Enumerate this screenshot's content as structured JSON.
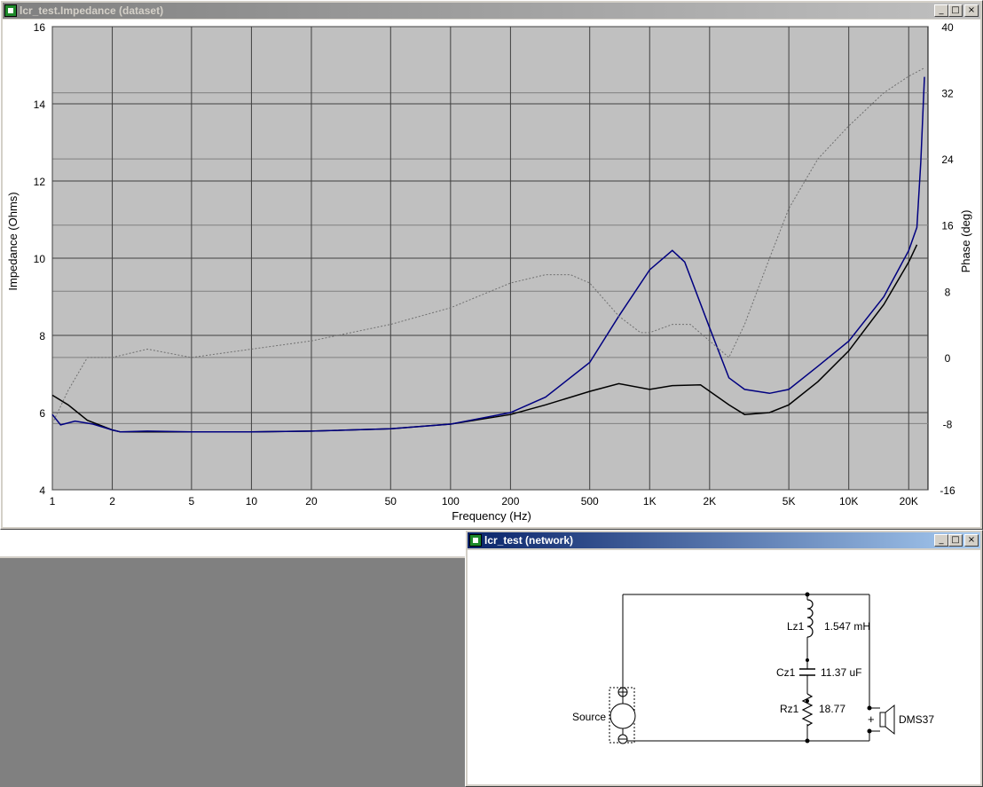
{
  "impedance_window": {
    "title": "lcr_test.Impedance (dataset)",
    "min_label": "_",
    "max_label": "□",
    "close_label": "×"
  },
  "network_window": {
    "title": "lcr_test (network)",
    "min_label": "_",
    "max_label": "□",
    "close_label": "×"
  },
  "schematic": {
    "source_label": "Source",
    "inductor_name": "Lz1",
    "inductor_value": "1.547 mH",
    "capacitor_name": "Cz1",
    "capacitor_value": "11.37 uF",
    "resistor_name": "Rz1",
    "resistor_value": "18.77",
    "driver_name": "DMS37",
    "plus_sign": "+"
  },
  "colors": {
    "plot_bg": "#c0c0c0",
    "grid": "#404040",
    "magnitude_blue": "#000080",
    "magnitude_black": "#000000",
    "phase_dotted": "#707070",
    "active_title": "#0a246a"
  },
  "chart_data": {
    "type": "line",
    "title": "",
    "xlabel": "Frequency (Hz)",
    "ylabel": "Impedance (Ohms)",
    "y2label": "Phase (deg)",
    "xscale": "log",
    "xlim": [
      1,
      25000
    ],
    "ylim": [
      4,
      16
    ],
    "y2lim": [
      -16,
      40
    ],
    "grid": true,
    "x_ticks": [
      1,
      2,
      5,
      10,
      20,
      50,
      100,
      200,
      500,
      1000,
      2000,
      5000,
      10000,
      20000
    ],
    "x_tick_labels": [
      "1",
      "2",
      "5",
      "10",
      "20",
      "50",
      "100",
      "200",
      "500",
      "1K",
      "2K",
      "5K",
      "10K",
      "20K"
    ],
    "y_ticks": [
      4,
      6,
      8,
      10,
      12,
      14,
      16
    ],
    "y_tick_labels": [
      "4",
      "6",
      "8",
      "10",
      "12",
      "14",
      "16"
    ],
    "y2_ticks": [
      -16,
      -8,
      0,
      8,
      16,
      24,
      32,
      40
    ],
    "y2_tick_labels": [
      "-16",
      "-8",
      "0",
      "8",
      "16",
      "24",
      "32",
      "40"
    ],
    "series": [
      {
        "axis": "y",
        "style": "solid",
        "color": "#000000",
        "x": [
          1,
          1.2,
          1.5,
          2,
          2.2,
          3,
          5,
          10,
          20,
          50,
          100,
          200,
          300,
          500,
          700,
          1000,
          1300,
          1800,
          2500,
          3000,
          4000,
          5000,
          7000,
          10000,
          15000,
          20000,
          22000
        ],
        "y": [
          6.45,
          6.2,
          5.8,
          5.55,
          5.5,
          5.5,
          5.5,
          5.5,
          5.52,
          5.58,
          5.7,
          5.95,
          6.2,
          6.55,
          6.75,
          6.6,
          6.7,
          6.72,
          6.2,
          5.95,
          6.0,
          6.2,
          6.8,
          7.6,
          8.8,
          9.9,
          10.35
        ]
      },
      {
        "axis": "y",
        "style": "solid",
        "color": "#000080",
        "x": [
          1,
          1.1,
          1.3,
          1.6,
          2,
          2.2,
          3,
          5,
          10,
          20,
          50,
          100,
          200,
          300,
          500,
          700,
          1000,
          1300,
          1500,
          2000,
          2500,
          3000,
          4000,
          5000,
          7000,
          10000,
          15000,
          20000,
          22000,
          23000,
          24000
        ],
        "y": [
          5.95,
          5.68,
          5.78,
          5.7,
          5.55,
          5.5,
          5.52,
          5.5,
          5.5,
          5.52,
          5.58,
          5.7,
          6.0,
          6.4,
          7.3,
          8.5,
          9.7,
          10.2,
          9.9,
          8.2,
          6.9,
          6.6,
          6.5,
          6.6,
          7.2,
          7.85,
          9.0,
          10.2,
          10.8,
          12.5,
          14.7
        ]
      },
      {
        "axis": "y2",
        "style": "dotted",
        "color": "#707070",
        "x": [
          1,
          1.2,
          1.5,
          2,
          3,
          5,
          10,
          20,
          50,
          100,
          200,
          300,
          400,
          500,
          700,
          900,
          1000,
          1300,
          1600,
          2000,
          2500,
          3000,
          4000,
          5000,
          7000,
          10000,
          15000,
          20000,
          24000
        ],
        "y": [
          -8,
          -4,
          0,
          0,
          1,
          0,
          1,
          2,
          4,
          6,
          9,
          10,
          10,
          9,
          5,
          3,
          3,
          4,
          4,
          2,
          0,
          4,
          12,
          18,
          24,
          28,
          32,
          34,
          35
        ]
      }
    ]
  }
}
